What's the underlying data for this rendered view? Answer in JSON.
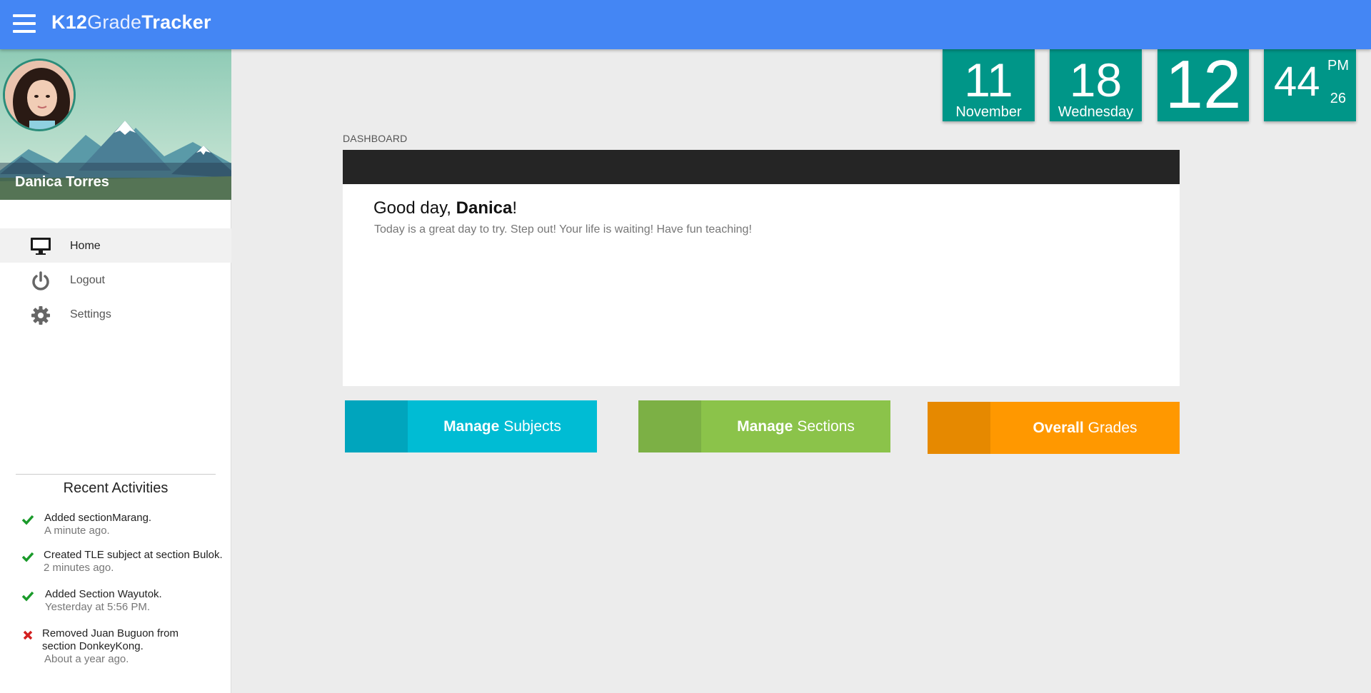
{
  "app": {
    "brand_part1": "K12",
    "brand_part2": "Grade",
    "brand_part3": "Tracker",
    "menu_icon": "hamburger-menu-icon"
  },
  "user": {
    "name": "Danica Torres"
  },
  "nav": {
    "items": [
      {
        "label": "Home",
        "icon": "monitor-icon",
        "active": true
      },
      {
        "label": "Logout",
        "icon": "power-icon",
        "active": false
      },
      {
        "label": "Settings",
        "icon": "gear-icon",
        "active": false
      }
    ]
  },
  "recent": {
    "title": "Recent Activities",
    "items": [
      {
        "status": "check",
        "line1": "Added sectionMarang.",
        "line2": "",
        "time": "A minute ago."
      },
      {
        "status": "check",
        "line1": "Created TLE subject at section Bulok.",
        "line2": "",
        "time": "2 minutes ago."
      },
      {
        "status": "check",
        "line1": "Added Section Wayutok.",
        "line2": "",
        "time": "Yesterday at 5:56 PM."
      },
      {
        "status": "cross",
        "line1": "Removed Juan Buguon from",
        "line2": "section DonkeyKong.",
        "time": "About a year ago."
      }
    ]
  },
  "clock": {
    "month_num": "11",
    "month_name": "November",
    "day_num": "18",
    "day_name": "Wednesday",
    "hour": "12",
    "minute": "44",
    "ampm": "PM",
    "second": "26"
  },
  "main": {
    "breadcrumb": "DASHBOARD",
    "greeting_prefix": "Good day, ",
    "greeting_name": "Danica",
    "greeting_suffix": "!",
    "message": "Today is a great day to try. Step out! Your life is waiting! Have fun teaching!"
  },
  "actions": [
    {
      "bold": "Manage",
      "light": "Subjects",
      "color": "#00bcd4",
      "stripe": "#00a5bd"
    },
    {
      "bold": "Manage",
      "light": "Sections",
      "color": "#8bc34a",
      "stripe": "#7cb045"
    },
    {
      "bold": "Overall",
      "light": "Grades",
      "color": "#ff9800",
      "stripe": "#e68900"
    }
  ]
}
